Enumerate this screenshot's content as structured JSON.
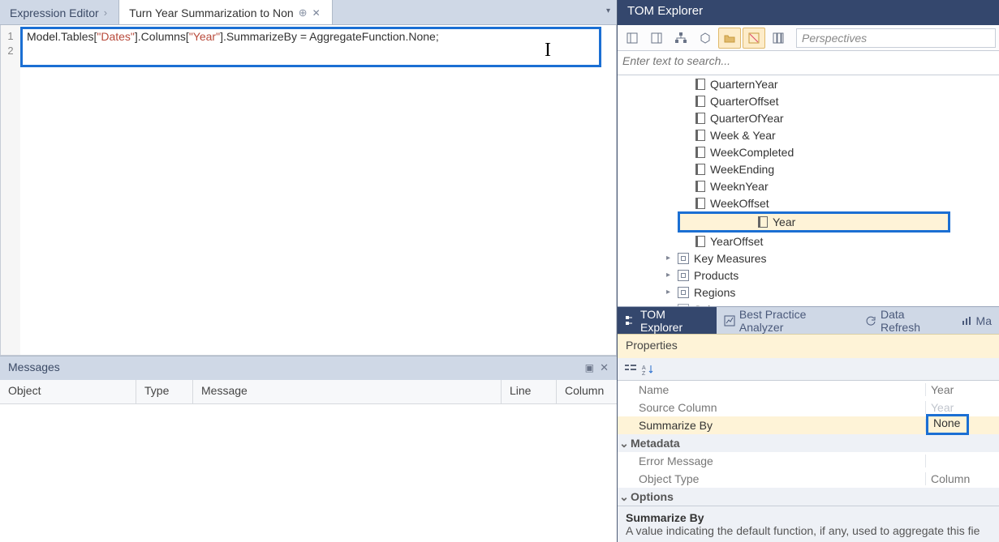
{
  "editor": {
    "tab_static": "Expression Editor",
    "tab_active": "Turn Year Summarization to Non",
    "gutter": [
      "1",
      "2"
    ],
    "code_text": "Model",
    "code_t2": ".Tables[",
    "code_s1": "\"Dates\"",
    "code_t3": "].Columns[",
    "code_s2": "\"Year\"",
    "code_t4": "].SummarizeBy = AggregateFunction.None;"
  },
  "messages": {
    "title": "Messages",
    "cols": {
      "object": "Object",
      "type": "Type",
      "message": "Message",
      "line": "Line",
      "column": "Column"
    }
  },
  "tom": {
    "title": "TOM Explorer",
    "perspectives_placeholder": "Perspectives",
    "search_placeholder": "Enter text to search...",
    "cols": [
      "QuarternYear",
      "QuarterOffset",
      "QuarterOfYear",
      "Week & Year",
      "WeekCompleted",
      "WeekEnding",
      "WeeknYear",
      "WeekOffset",
      "Year",
      "YearOffset"
    ],
    "tables": [
      "Key Measures",
      "Products",
      "Regions",
      "Sales"
    ]
  },
  "exp_tabs": {
    "tom": "TOM Explorer",
    "bpa": "Best Practice Analyzer",
    "refresh": "Data Refresh",
    "ma": "Ma"
  },
  "properties": {
    "title": "Properties",
    "rows": {
      "name_k": "Name",
      "name_v": "Year",
      "source_k": "Source Column",
      "source_v": "Year",
      "sum_k": "Summarize By",
      "sum_v": "None",
      "meta_group": "Metadata",
      "err_k": "Error Message",
      "err_v": "",
      "objtype_k": "Object Type",
      "objtype_v": "Column",
      "opt_group": "Options"
    },
    "desc_title": "Summarize By",
    "desc_body": "A value indicating the default function, if any, used to aggregate this fie"
  },
  "chart_data": null
}
